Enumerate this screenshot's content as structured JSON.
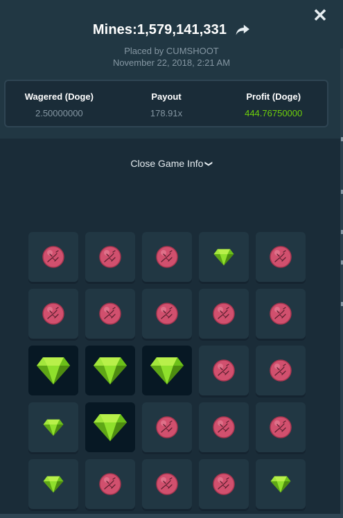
{
  "header": {
    "game_id": "Mines:1,579,141,331",
    "placed_by": "Placed by CUMSHOOT",
    "date": "November 22, 2018, 2:21 AM",
    "close_symbol": "✕",
    "share_icon": "share-arrow-icon"
  },
  "stats": {
    "wagered_label": "Wagered (Doge)",
    "wagered_value": "2.50000000",
    "payout_label": "Payout",
    "payout_value": "178.91x",
    "profit_label": "Profit (Doge)",
    "profit_value": "444.76750000"
  },
  "close_info": {
    "label": "Close Game Info",
    "icon": "chevron-down-icon"
  },
  "colors": {
    "background": "#1a2c38",
    "panel": "#213743",
    "profit_green": "#6fd10a",
    "gem": "#7ed321",
    "mine": "#c2425f"
  },
  "board": {
    "rows": 5,
    "cols": 5,
    "cells": [
      [
        "mine",
        "mine",
        "mine",
        "gem",
        "mine"
      ],
      [
        "mine",
        "mine",
        "mine",
        "mine",
        "mine"
      ],
      [
        "gem-revealed",
        "gem-revealed",
        "gem-revealed",
        "mine",
        "mine"
      ],
      [
        "gem",
        "gem-revealed",
        "mine",
        "mine",
        "mine"
      ],
      [
        "gem",
        "mine",
        "mine",
        "mine",
        "gem"
      ]
    ]
  }
}
